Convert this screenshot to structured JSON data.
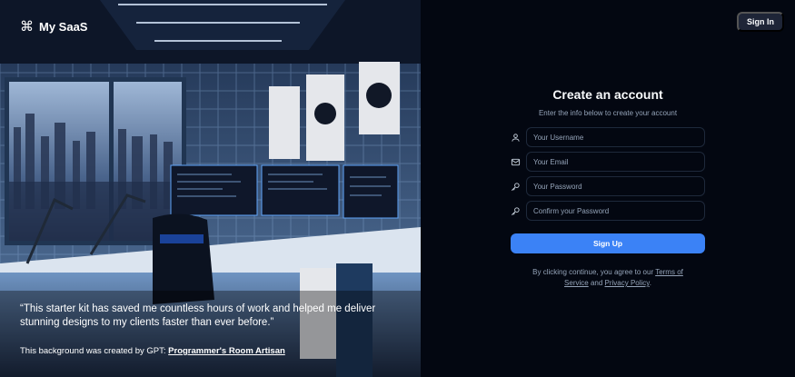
{
  "brand": {
    "icon": "command-icon",
    "name": "My SaaS"
  },
  "hero": {
    "quote": "“This starter kit has saved me countless hours of work and helped me deliver stunning designs to my clients faster than ever before.”",
    "credit_prefix": "This background was created by GPT: ",
    "credit_link": "Programmer's Room Artisan"
  },
  "header": {
    "signin_label": "Sign In"
  },
  "form": {
    "title": "Create an account",
    "subtitle": "Enter the info below to create your account",
    "fields": [
      {
        "icon": "user-icon",
        "placeholder": "Your Username"
      },
      {
        "icon": "mail-icon",
        "placeholder": "Your Email"
      },
      {
        "icon": "key-icon",
        "placeholder": "Your Password"
      },
      {
        "icon": "key-icon",
        "placeholder": "Confirm your Password"
      }
    ],
    "submit_label": "Sign Up",
    "terms_prefix": "By clicking continue, you agree to our ",
    "terms_link": "Terms of Service",
    "terms_and": " and ",
    "privacy_link": "Privacy Policy",
    "terms_suffix": "."
  },
  "colors": {
    "background": "#030711",
    "accent": "#3b82f6",
    "muted": "#94a3b8"
  }
}
